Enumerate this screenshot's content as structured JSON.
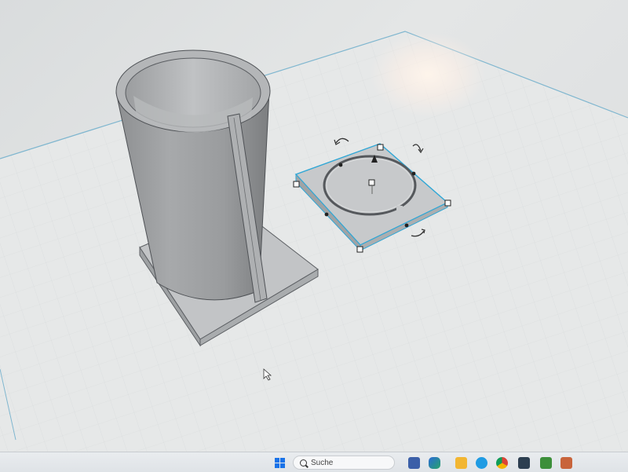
{
  "taskbar": {
    "search_label": "Suche",
    "icons": [
      "windows-start-icon",
      "search-icon",
      "app-icon",
      "copilot-icon",
      "file-explorer-icon",
      "edge-icon",
      "chrome-icon",
      "app-icon-2",
      "minecraft-icon",
      "app-icon-3"
    ]
  },
  "viewport": {
    "objects": [
      "hollow-cylinder-with-base",
      "selected-square-base-plate"
    ],
    "accent": "#2fa7d6"
  }
}
